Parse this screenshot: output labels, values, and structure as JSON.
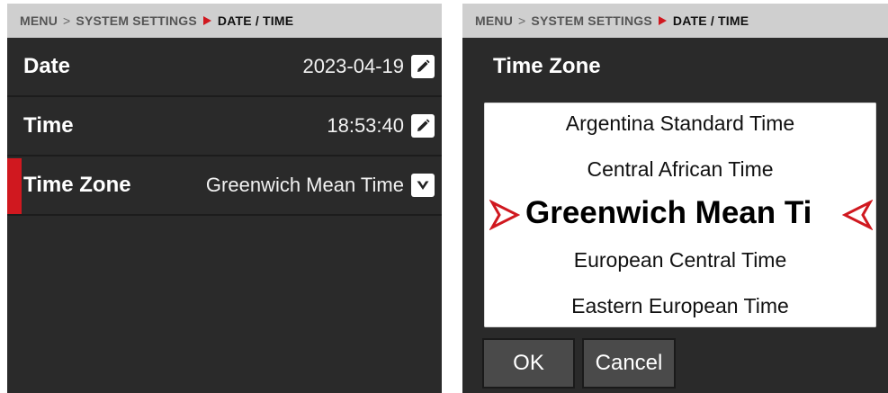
{
  "breadcrumb": {
    "items": [
      "MENU",
      "SYSTEM SETTINGS",
      "DATE / TIME"
    ],
    "separator": ">"
  },
  "settings": {
    "rows": [
      {
        "label": "Date",
        "value": "2023-04-19",
        "icon": "pencil-icon"
      },
      {
        "label": "Time",
        "value": "18:53:40",
        "icon": "pencil-icon"
      },
      {
        "label": "Time Zone",
        "value": "Greenwich Mean Time",
        "icon": "chevron-down-icon"
      }
    ],
    "selected_index": 2
  },
  "dialog": {
    "title": "Time Zone",
    "options": [
      "Argentina Standard Time",
      "Central African Time",
      "Greenwich Mean Ti",
      "European Central Time",
      "Eastern European Time"
    ],
    "selected_index": 2,
    "ok_label": "OK",
    "cancel_label": "Cancel"
  },
  "colors": {
    "accent": "#d0181f",
    "panel_bg": "#2a2a2a",
    "breadcrumb_bg": "#cfcfcf",
    "button_bg": "#4a4a4a"
  }
}
